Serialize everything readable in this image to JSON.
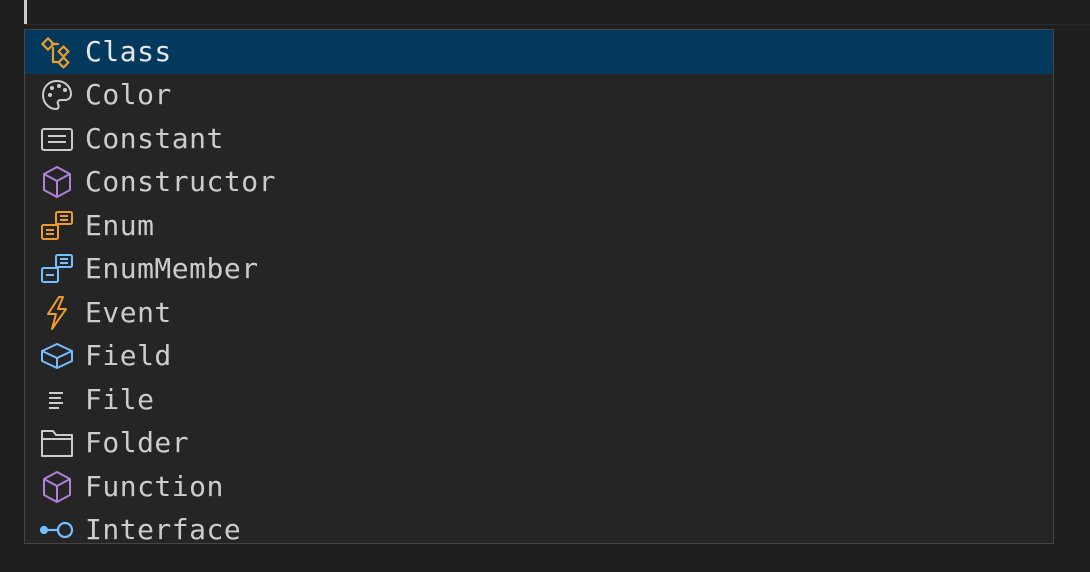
{
  "colors": {
    "background": "#1f1f1f",
    "widget_background": "#252526",
    "widget_border": "#454545",
    "selected_background": "#04395e",
    "label_text": "#cccccc",
    "orange": "#ee9d28",
    "purple": "#b180d7",
    "blue": "#75beff",
    "gray": "#cccccc"
  },
  "suggestions": [
    {
      "label": "Class",
      "icon": "symbol-class-icon",
      "selected": true
    },
    {
      "label": "Color",
      "icon": "symbol-color-icon",
      "selected": false
    },
    {
      "label": "Constant",
      "icon": "symbol-constant-icon",
      "selected": false
    },
    {
      "label": "Constructor",
      "icon": "symbol-constructor-icon",
      "selected": false
    },
    {
      "label": "Enum",
      "icon": "symbol-enum-icon",
      "selected": false
    },
    {
      "label": "EnumMember",
      "icon": "symbol-enum-member-icon",
      "selected": false
    },
    {
      "label": "Event",
      "icon": "symbol-event-icon",
      "selected": false
    },
    {
      "label": "Field",
      "icon": "symbol-field-icon",
      "selected": false
    },
    {
      "label": "File",
      "icon": "symbol-file-icon",
      "selected": false
    },
    {
      "label": "Folder",
      "icon": "symbol-folder-icon",
      "selected": false
    },
    {
      "label": "Function",
      "icon": "symbol-function-icon",
      "selected": false
    },
    {
      "label": "Interface",
      "icon": "symbol-interface-icon",
      "selected": false
    }
  ]
}
